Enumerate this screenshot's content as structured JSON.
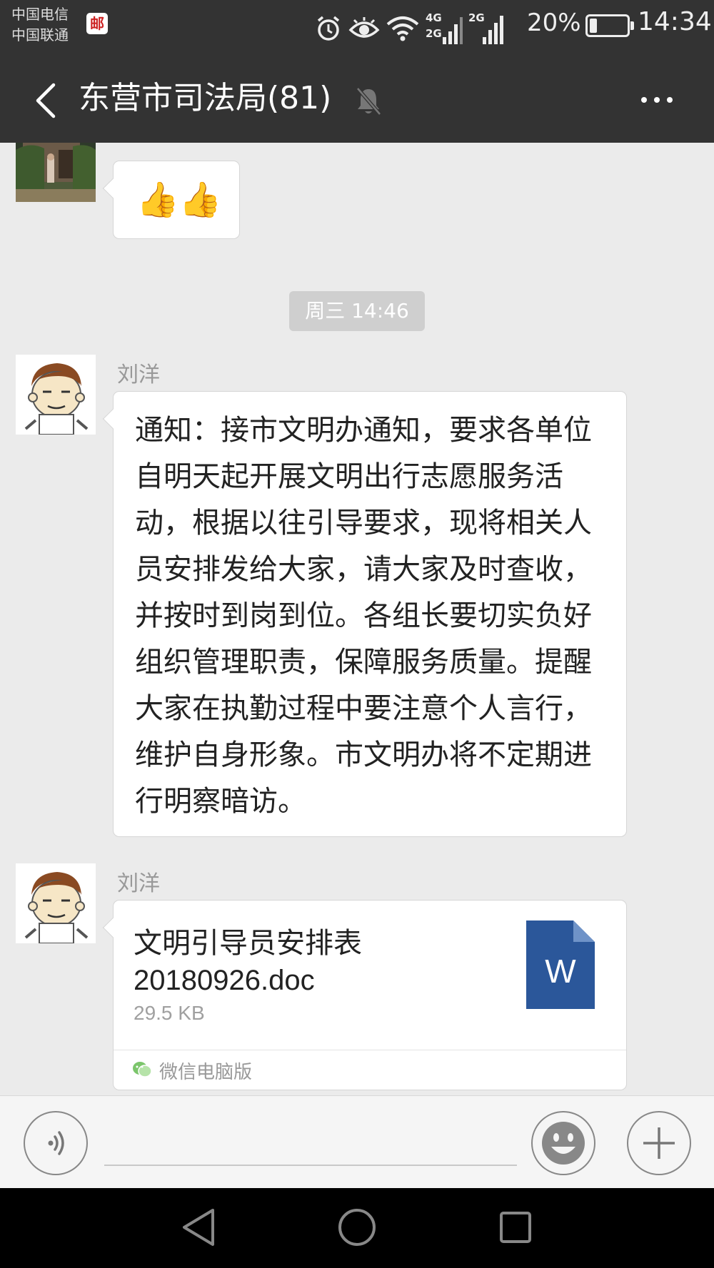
{
  "status_bar": {
    "carrier_1": "中国电信",
    "carrier_2": "中国联通",
    "badge": "邮",
    "net_1_top": "4G",
    "net_1_bottom": "2G",
    "net_2": "2G",
    "battery_percent": "20%",
    "battery_level": 0.2,
    "time": "14:34"
  },
  "header": {
    "title": "东营市司法局(81)"
  },
  "messages": {
    "top_emoji": "👍👍",
    "time_divider": "周三 14:46",
    "notice": {
      "sender": "刘洋",
      "text": "通知：接市文明办通知，要求各单位自明天起开展文明出行志愿服务活动，根据以往引导要求，现将相关人员安排发给大家，请大家及时查收，并按时到岗到位。各组长要切实负好组织管理职责，保障服务质量。提醒大家在执勤过程中要注意个人言行，维护自身形象。市文明办将不定期进行明察暗访。"
    },
    "file": {
      "sender": "刘洋",
      "name": "文明引导员安排表20180926.doc",
      "size": "29.5 KB",
      "icon_letter": "W",
      "footer": "微信电脑版"
    }
  },
  "colors": {
    "bar_bg": "#333333",
    "chat_bg": "#ebebeb",
    "word_blue": "#2b579a"
  }
}
